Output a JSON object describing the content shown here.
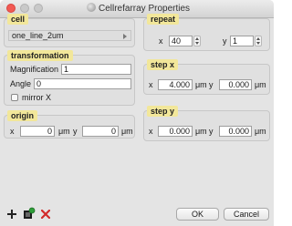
{
  "window": {
    "title": "Cellrefarray Properties"
  },
  "cell": {
    "title": "cell",
    "value": "one_line_2um"
  },
  "transformation": {
    "title": "transformation",
    "magnification_label": "Magnification",
    "magnification_value": "1",
    "angle_label": "Angle",
    "angle_value": "0",
    "mirror_label": "mirror X",
    "mirror_checked": false
  },
  "origin": {
    "title": "origin",
    "x_label": "x",
    "x_value": "0",
    "x_unit": "μm",
    "y_label": "y",
    "y_value": "0",
    "y_unit": "μm"
  },
  "repeat": {
    "title": "repeat",
    "x_label": "x",
    "x_value": "40",
    "y_label": "y",
    "y_value": "1"
  },
  "step_x": {
    "title": "step x",
    "x_label": "x",
    "x_value": "4.000",
    "x_unit": "μm",
    "y_label": "y",
    "y_value": "0.000",
    "y_unit": "μm"
  },
  "step_y": {
    "title": "step y",
    "x_label": "x",
    "x_value": "0.000",
    "x_unit": "μm",
    "y_label": "y",
    "y_value": "0.000",
    "y_unit": "μm"
  },
  "buttons": {
    "ok": "OK",
    "cancel": "Cancel"
  },
  "icons": {
    "add": "plus-icon",
    "library": "library-icon",
    "delete": "delete-icon"
  },
  "colors": {
    "panel_title_bg": "#f2e79a",
    "close_light": "#f25a54",
    "delete_red": "#d22b2b"
  }
}
